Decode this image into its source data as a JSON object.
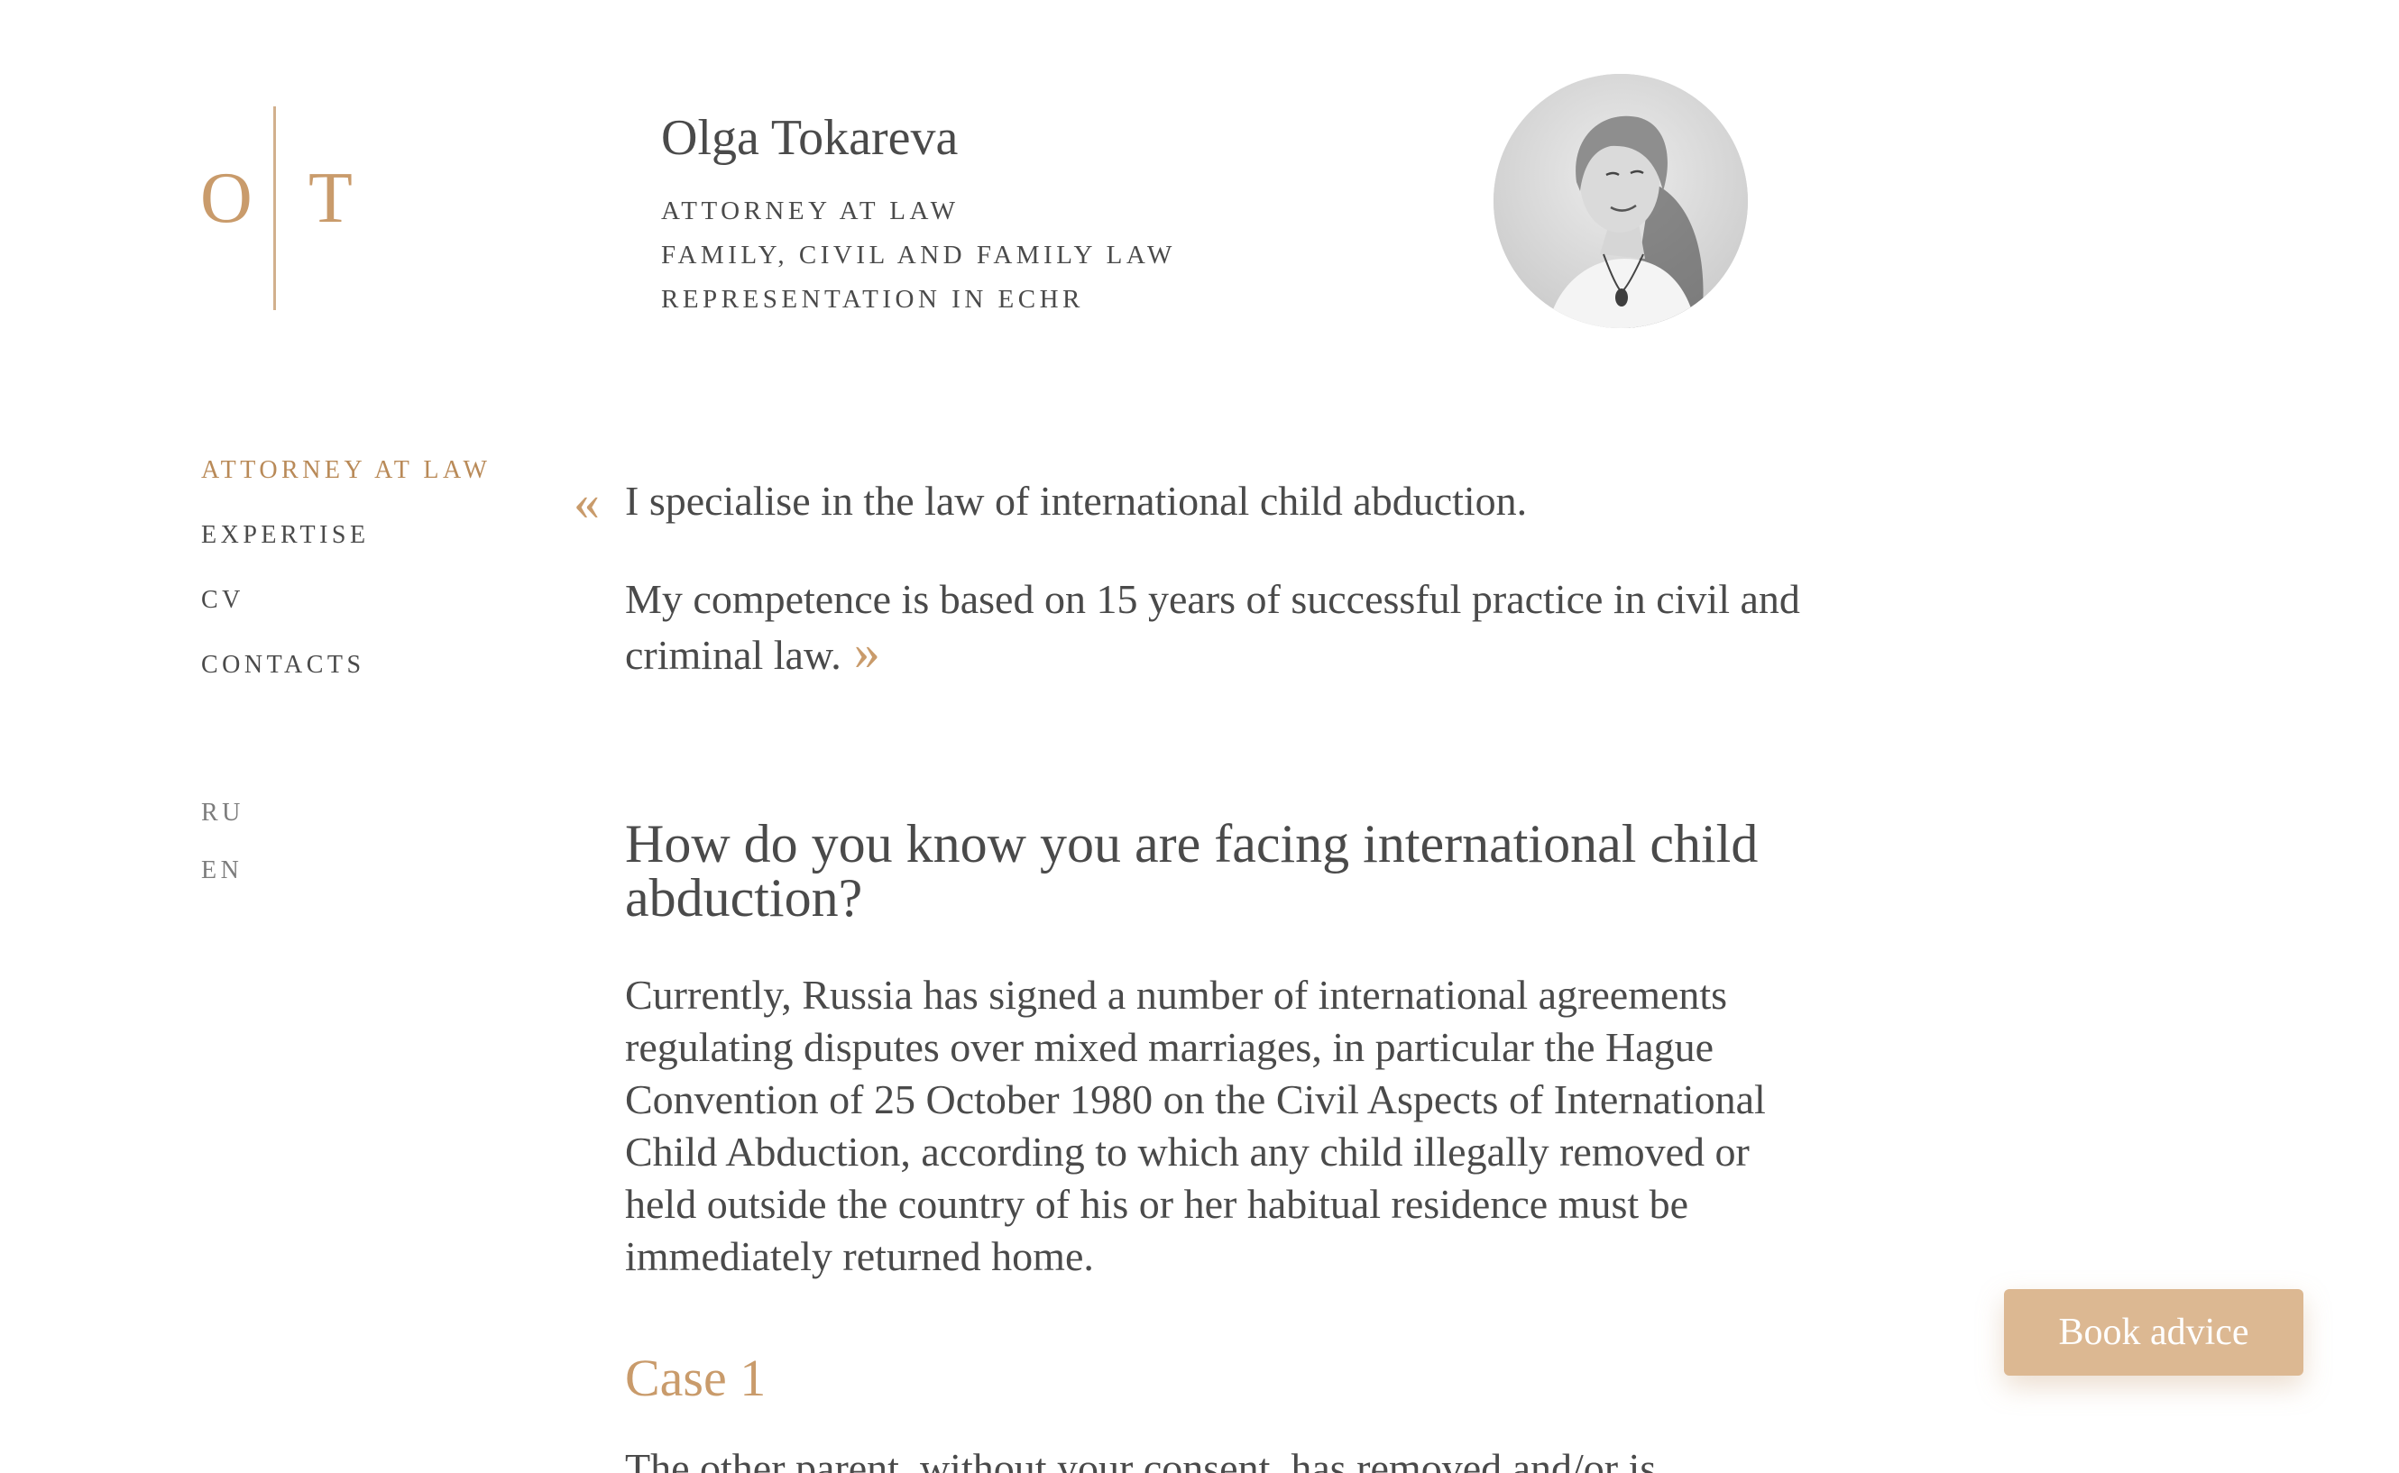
{
  "monogram": {
    "left": "O",
    "right": "T"
  },
  "header": {
    "name": "Olga Tokareva",
    "titles": [
      "ATTORNEY AT LAW",
      "FAMILY, CIVIL AND FAMILY LAW",
      "REPRESENTATION IN ECHR"
    ]
  },
  "nav": {
    "items": [
      {
        "label": "ATTORNEY AT LAW",
        "active": true
      },
      {
        "label": "EXPERTISE",
        "active": false
      },
      {
        "label": "CV",
        "active": false
      },
      {
        "label": "CONTACTS",
        "active": false
      }
    ],
    "languages": [
      "RU",
      "EN"
    ]
  },
  "quote": {
    "open_mark": "«",
    "line1": "I specialise in the law of international child abduction.",
    "line2": "My competence is based on 15 years of successful practice in civil and criminal law.",
    "close_mark": "»"
  },
  "article": {
    "title": "How do you know you are facing international child abduction?",
    "body": "Currently, Russia has signed a number of international agreements regulating disputes over mixed marriages, in particular the Hague Convention of 25 October 1980 on the Civil Aspects of International Child Abduction, according to which any child illegally removed or held outside the country of his or her habitual residence must be immediately returned home.",
    "case_heading": "Case 1",
    "case_text": "The other parent, without your consent, has removed and/or is"
  },
  "cta": {
    "label": "Book advice"
  },
  "colors": {
    "accent": "#c99b6b",
    "text": "#4a4a4a",
    "button_bg": "#dcb892"
  }
}
